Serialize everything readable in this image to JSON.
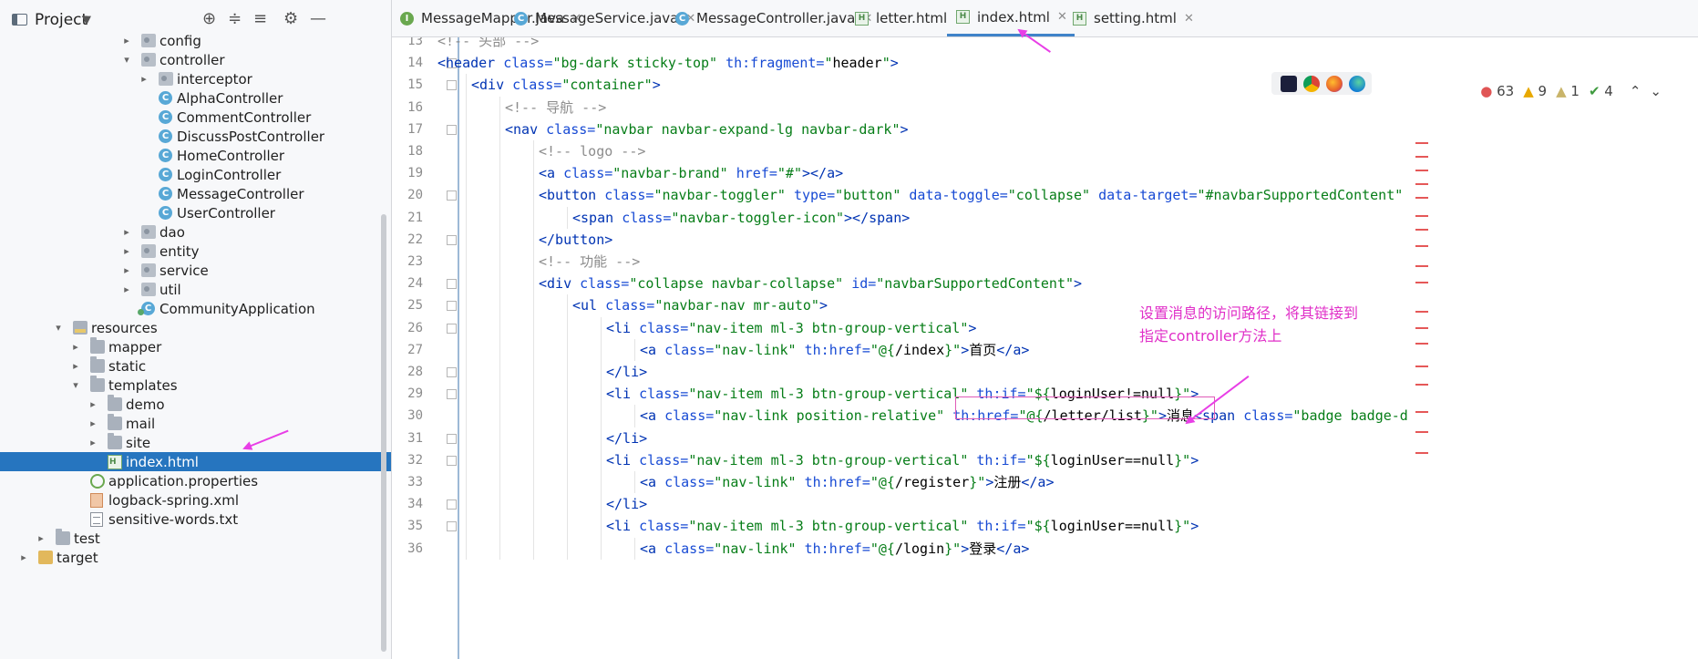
{
  "project_panel": {
    "title": "Project",
    "tree": [
      {
        "label": "config",
        "icon": "package-icon",
        "indent": 155,
        "chev": "›"
      },
      {
        "label": "controller",
        "icon": "package-icon",
        "indent": 155,
        "chev": "⌄"
      },
      {
        "label": "interceptor",
        "icon": "package-icon",
        "indent": 174,
        "chev": "›"
      },
      {
        "label": "AlphaController",
        "icon": "class-icon",
        "indent": 174,
        "chev": ""
      },
      {
        "label": "CommentController",
        "icon": "class-icon",
        "indent": 174,
        "chev": ""
      },
      {
        "label": "DiscussPostController",
        "icon": "class-icon",
        "indent": 174,
        "chev": ""
      },
      {
        "label": "HomeController",
        "icon": "class-icon",
        "indent": 174,
        "chev": ""
      },
      {
        "label": "LoginController",
        "icon": "class-icon",
        "indent": 174,
        "chev": ""
      },
      {
        "label": "MessageController",
        "icon": "class-icon",
        "indent": 174,
        "chev": ""
      },
      {
        "label": "UserController",
        "icon": "class-icon",
        "indent": 174,
        "chev": ""
      },
      {
        "label": "dao",
        "icon": "package-icon",
        "indent": 155,
        "chev": "›"
      },
      {
        "label": "entity",
        "icon": "package-icon",
        "indent": 155,
        "chev": "›"
      },
      {
        "label": "service",
        "icon": "package-icon",
        "indent": 155,
        "chev": "›"
      },
      {
        "label": "util",
        "icon": "package-icon",
        "indent": 155,
        "chev": "›"
      },
      {
        "label": "CommunityApplication",
        "icon": "spring-class-icon",
        "indent": 155,
        "chev": ""
      },
      {
        "label": "resources",
        "icon": "resources-folder-icon",
        "indent": 80,
        "chev": "⌄"
      },
      {
        "label": "mapper",
        "icon": "folder-icon",
        "indent": 99,
        "chev": "›"
      },
      {
        "label": "static",
        "icon": "folder-icon",
        "indent": 99,
        "chev": "›"
      },
      {
        "label": "templates",
        "icon": "folder-icon",
        "indent": 99,
        "chev": "⌄"
      },
      {
        "label": "demo",
        "icon": "folder-icon",
        "indent": 118,
        "chev": "›"
      },
      {
        "label": "mail",
        "icon": "folder-icon",
        "indent": 118,
        "chev": "›"
      },
      {
        "label": "site",
        "icon": "folder-icon",
        "indent": 118,
        "chev": "›"
      },
      {
        "label": "index.html",
        "icon": "html-file-icon",
        "indent": 118,
        "chev": "",
        "selected": true
      },
      {
        "label": "application.properties",
        "icon": "properties-file-icon",
        "indent": 99,
        "chev": ""
      },
      {
        "label": "logback-spring.xml",
        "icon": "xml-file-icon",
        "indent": 99,
        "chev": ""
      },
      {
        "label": "sensitive-words.txt",
        "icon": "text-file-icon",
        "indent": 99,
        "chev": ""
      },
      {
        "label": "test",
        "icon": "folder-icon",
        "indent": 61,
        "chev": "›"
      },
      {
        "label": "target",
        "icon": "target-folder-icon",
        "indent": 42,
        "chev": "›"
      }
    ]
  },
  "tabs": [
    {
      "label": "MessageMapper.java",
      "icon": "interface-icon",
      "glyph": "I"
    },
    {
      "label": "MessageService.java",
      "icon": "class-icon",
      "glyph": "C"
    },
    {
      "label": "MessageController.java",
      "icon": "class-icon",
      "glyph": "C"
    },
    {
      "label": "letter.html",
      "icon": "html-file-icon",
      "glyph": "H"
    },
    {
      "label": "index.html",
      "icon": "html-file-icon",
      "glyph": "H",
      "active": true
    },
    {
      "label": "setting.html",
      "icon": "html-file-icon",
      "glyph": "H"
    }
  ],
  "inspections": {
    "errors": "63",
    "warnings": "9",
    "weak_warnings": "1",
    "typos": "4"
  },
  "annotation": "设置消息的访问路径，将其链接到\n指定controller方法上",
  "code_lines": [
    {
      "n": "13",
      "indent": 0,
      "parts": [
        [
          "c",
          "<!-- 头部 -->"
        ]
      ]
    },
    {
      "n": "14",
      "indent": 0,
      "parts": [
        [
          "t",
          "<header "
        ],
        [
          "a",
          "class="
        ],
        [
          "v",
          "\"bg-dark sticky-top\" "
        ],
        [
          "a",
          "th:fragment="
        ],
        [
          "v",
          "\""
        ],
        [
          "g",
          "header"
        ],
        [
          "v",
          "\""
        ],
        [
          "t",
          ">"
        ]
      ]
    },
    {
      "n": "15",
      "indent": 1,
      "parts": [
        [
          "t",
          "<div "
        ],
        [
          "a",
          "class="
        ],
        [
          "v",
          "\"container\""
        ],
        [
          "t",
          ">"
        ]
      ]
    },
    {
      "n": "16",
      "indent": 2,
      "parts": [
        [
          "c",
          "<!-- 导航 -->"
        ]
      ]
    },
    {
      "n": "17",
      "indent": 2,
      "parts": [
        [
          "t",
          "<nav "
        ],
        [
          "a",
          "class="
        ],
        [
          "v",
          "\"navbar navbar-expand-lg navbar-dark\""
        ],
        [
          "t",
          ">"
        ]
      ]
    },
    {
      "n": "18",
      "indent": 3,
      "parts": [
        [
          "c",
          "<!-- logo -->"
        ]
      ]
    },
    {
      "n": "19",
      "indent": 3,
      "parts": [
        [
          "t",
          "<a "
        ],
        [
          "a",
          "class="
        ],
        [
          "v",
          "\"navbar-brand\" "
        ],
        [
          "a",
          "href="
        ],
        [
          "v",
          "\"#\""
        ],
        [
          "t",
          "></a>"
        ]
      ]
    },
    {
      "n": "20",
      "indent": 3,
      "parts": [
        [
          "t",
          "<button "
        ],
        [
          "a",
          "class="
        ],
        [
          "v",
          "\"navbar-toggler\" "
        ],
        [
          "a",
          "type="
        ],
        [
          "v",
          "\"button\" "
        ],
        [
          "a",
          "data-toggle="
        ],
        [
          "v",
          "\"collapse\" "
        ],
        [
          "a",
          "data-target="
        ],
        [
          "v",
          "\"#navbarSupportedContent\""
        ]
      ]
    },
    {
      "n": "21",
      "indent": 4,
      "parts": [
        [
          "t",
          "<span "
        ],
        [
          "a",
          "class="
        ],
        [
          "v",
          "\"navbar-toggler-icon\""
        ],
        [
          "t",
          "></span>"
        ]
      ]
    },
    {
      "n": "22",
      "indent": 3,
      "parts": [
        [
          "t",
          "</button>"
        ]
      ]
    },
    {
      "n": "23",
      "indent": 3,
      "parts": [
        [
          "c",
          "<!-- 功能 -->"
        ]
      ]
    },
    {
      "n": "24",
      "indent": 3,
      "parts": [
        [
          "t",
          "<div "
        ],
        [
          "a",
          "class="
        ],
        [
          "v",
          "\"collapse navbar-collapse\" "
        ],
        [
          "a",
          "id="
        ],
        [
          "v",
          "\"navbarSupportedContent\""
        ],
        [
          "t",
          ">"
        ]
      ]
    },
    {
      "n": "25",
      "indent": 4,
      "parts": [
        [
          "t",
          "<ul "
        ],
        [
          "a",
          "class="
        ],
        [
          "v",
          "\"navbar-nav mr-auto\""
        ],
        [
          "t",
          ">"
        ]
      ]
    },
    {
      "n": "26",
      "indent": 5,
      "parts": [
        [
          "t",
          "<li "
        ],
        [
          "a",
          "class="
        ],
        [
          "v",
          "\"nav-item ml-3 btn-group-vertical\""
        ],
        [
          "t",
          ">"
        ]
      ]
    },
    {
      "n": "27",
      "indent": 6,
      "parts": [
        [
          "t",
          "<a "
        ],
        [
          "a",
          "class="
        ],
        [
          "v",
          "\"nav-link\" "
        ],
        [
          "a",
          "th:href="
        ],
        [
          "v",
          "\"@{"
        ],
        [
          "g",
          "/index"
        ],
        [
          "v",
          "}\""
        ],
        [
          "t",
          ">"
        ],
        [
          "g",
          "首页"
        ],
        [
          "t",
          "</a>"
        ]
      ]
    },
    {
      "n": "28",
      "indent": 5,
      "parts": [
        [
          "t",
          "</li>"
        ]
      ]
    },
    {
      "n": "29",
      "indent": 5,
      "parts": [
        [
          "t",
          "<li "
        ],
        [
          "a",
          "class="
        ],
        [
          "v",
          "\"nav-item ml-3 btn-group-vertical\" "
        ],
        [
          "a",
          "th:if="
        ],
        [
          "v",
          "\"${"
        ],
        [
          "g",
          "loginUser!=null"
        ],
        [
          "v",
          "}\""
        ],
        [
          "t",
          ">"
        ]
      ]
    },
    {
      "n": "30",
      "indent": 6,
      "parts": [
        [
          "t",
          "<a "
        ],
        [
          "a",
          "class="
        ],
        [
          "v",
          "\"nav-link position-relative\" "
        ],
        [
          "a",
          "th:href="
        ],
        [
          "v",
          "\"@{"
        ],
        [
          "g",
          "/letter/list"
        ],
        [
          "v",
          "}\""
        ],
        [
          "t",
          ">"
        ],
        [
          "g",
          "消息"
        ],
        [
          "t",
          "<span "
        ],
        [
          "a",
          "class="
        ],
        [
          "v",
          "\"badge badge-d"
        ]
      ]
    },
    {
      "n": "31",
      "indent": 5,
      "parts": [
        [
          "t",
          "</li>"
        ]
      ]
    },
    {
      "n": "32",
      "indent": 5,
      "parts": [
        [
          "t",
          "<li "
        ],
        [
          "a",
          "class="
        ],
        [
          "v",
          "\"nav-item ml-3 btn-group-vertical\" "
        ],
        [
          "a",
          "th:if="
        ],
        [
          "v",
          "\"${"
        ],
        [
          "g",
          "loginUser==null"
        ],
        [
          "v",
          "}\""
        ],
        [
          "t",
          ">"
        ]
      ]
    },
    {
      "n": "33",
      "indent": 6,
      "parts": [
        [
          "t",
          "<a "
        ],
        [
          "a",
          "class="
        ],
        [
          "v",
          "\"nav-link\" "
        ],
        [
          "a",
          "th:href="
        ],
        [
          "v",
          "\"@{"
        ],
        [
          "g",
          "/register"
        ],
        [
          "v",
          "}\""
        ],
        [
          "t",
          ">"
        ],
        [
          "g",
          "注册"
        ],
        [
          "t",
          "</a>"
        ]
      ]
    },
    {
      "n": "34",
      "indent": 5,
      "parts": [
        [
          "t",
          "</li>"
        ]
      ]
    },
    {
      "n": "35",
      "indent": 5,
      "parts": [
        [
          "t",
          "<li "
        ],
        [
          "a",
          "class="
        ],
        [
          "v",
          "\"nav-item ml-3 btn-group-vertical\" "
        ],
        [
          "a",
          "th:if="
        ],
        [
          "v",
          "\"${"
        ],
        [
          "g",
          "loginUser==null"
        ],
        [
          "v",
          "}\""
        ],
        [
          "t",
          ">"
        ]
      ]
    },
    {
      "n": "36",
      "indent": 6,
      "parts": [
        [
          "t",
          "<a "
        ],
        [
          "a",
          "class="
        ],
        [
          "v",
          "\"nav-link\" "
        ],
        [
          "a",
          "th:href="
        ],
        [
          "v",
          "\"@{"
        ],
        [
          "g",
          "/login"
        ],
        [
          "v",
          "}\""
        ],
        [
          "t",
          ">"
        ],
        [
          "g",
          "登录"
        ],
        [
          "t",
          "</a>"
        ]
      ]
    }
  ],
  "colors": {
    "accent": "#2675bf",
    "annotation": "#e02fc8",
    "tag": "#0033b3",
    "attr": "#174ad4",
    "string": "#067d17"
  }
}
